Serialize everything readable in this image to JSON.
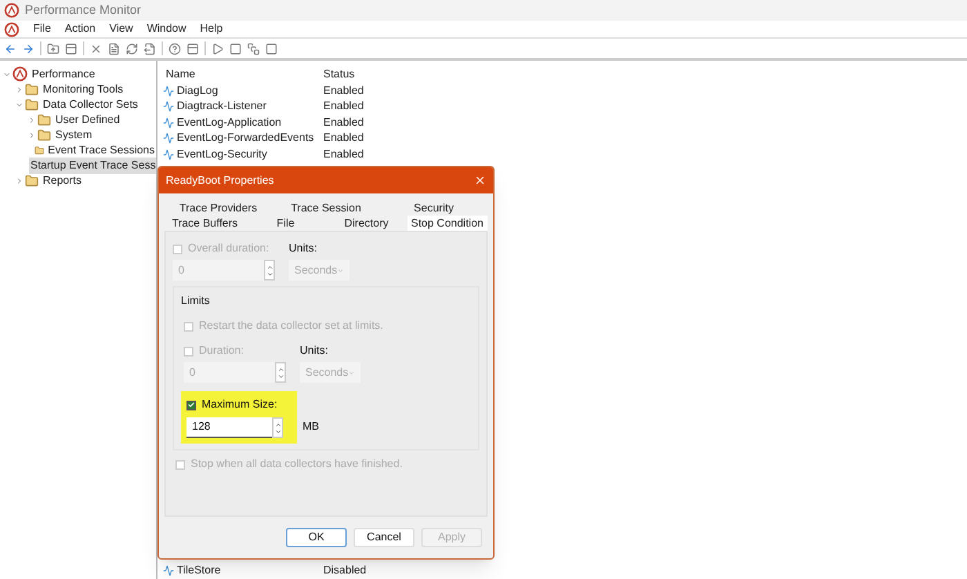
{
  "window": {
    "title": "Performance Monitor"
  },
  "menu": [
    "File",
    "Action",
    "View",
    "Window",
    "Help"
  ],
  "tree": [
    {
      "label": "Performance",
      "selected": false,
      "expanded": true,
      "children": [
        {
          "label": "Monitoring Tools",
          "selected": false,
          "expanded": false
        },
        {
          "label": "Data Collector Sets",
          "selected": false,
          "expanded": true,
          "children": [
            {
              "label": "User Defined",
              "selected": false,
              "expanded": false
            },
            {
              "label": "System",
              "selected": false,
              "expanded": false
            },
            {
              "label": "Event Trace Sessions",
              "selected": false
            },
            {
              "label": "Startup Event Trace Sess",
              "selected": true
            }
          ]
        },
        {
          "label": "Reports",
          "selected": false,
          "expanded": false
        }
      ]
    }
  ],
  "table": {
    "columns": [
      "Name",
      "Status"
    ],
    "rows": [
      {
        "name": "DiagLog",
        "status": "Enabled"
      },
      {
        "name": "Diagtrack-Listener",
        "status": "Enabled"
      },
      {
        "name": "EventLog-Application",
        "status": "Enabled"
      },
      {
        "name": "EventLog-ForwardedEvents",
        "status": "Enabled"
      },
      {
        "name": "EventLog-Security",
        "status": "Enabled"
      },
      {
        "name": "TileStore",
        "status": "Disabled"
      }
    ]
  },
  "dialog": {
    "title": "ReadyBoot Properties",
    "tab_rows": [
      [
        {
          "label": "Trace Providers",
          "selected": false
        },
        {
          "label": "Trace Session",
          "selected": false
        },
        {
          "label": "Security",
          "selected": false
        }
      ],
      [
        {
          "label": "Trace Buffers",
          "selected": false
        },
        {
          "label": "File",
          "selected": false
        },
        {
          "label": "Directory",
          "selected": false
        },
        {
          "label": "Stop Condition",
          "selected": true
        }
      ]
    ],
    "overall": {
      "label": "Overall duration:",
      "checked": false,
      "disabled": true,
      "value": "0",
      "units_label": "Units:",
      "units": "Seconds"
    },
    "limits": {
      "title": "Limits",
      "restart": {
        "label": "Restart the data collector set at limits.",
        "checked": false,
        "disabled": true
      },
      "duration": {
        "label": "Duration:",
        "checked": false,
        "disabled": true,
        "value": "0",
        "units_label": "Units:",
        "units": "Seconds"
      },
      "max_size": {
        "label": "Maximum Size:",
        "checked": true,
        "disabled": false,
        "value": "128",
        "unit": "MB",
        "highlighted": true
      }
    },
    "stop_all": {
      "label": "Stop when all data collectors have finished.",
      "checked": false,
      "disabled": true
    },
    "buttons": [
      {
        "label": "OK",
        "disabled": false,
        "default": true
      },
      {
        "label": "Cancel",
        "disabled": false,
        "default": false
      },
      {
        "label": "Apply",
        "disabled": true,
        "default": false
      }
    ]
  }
}
